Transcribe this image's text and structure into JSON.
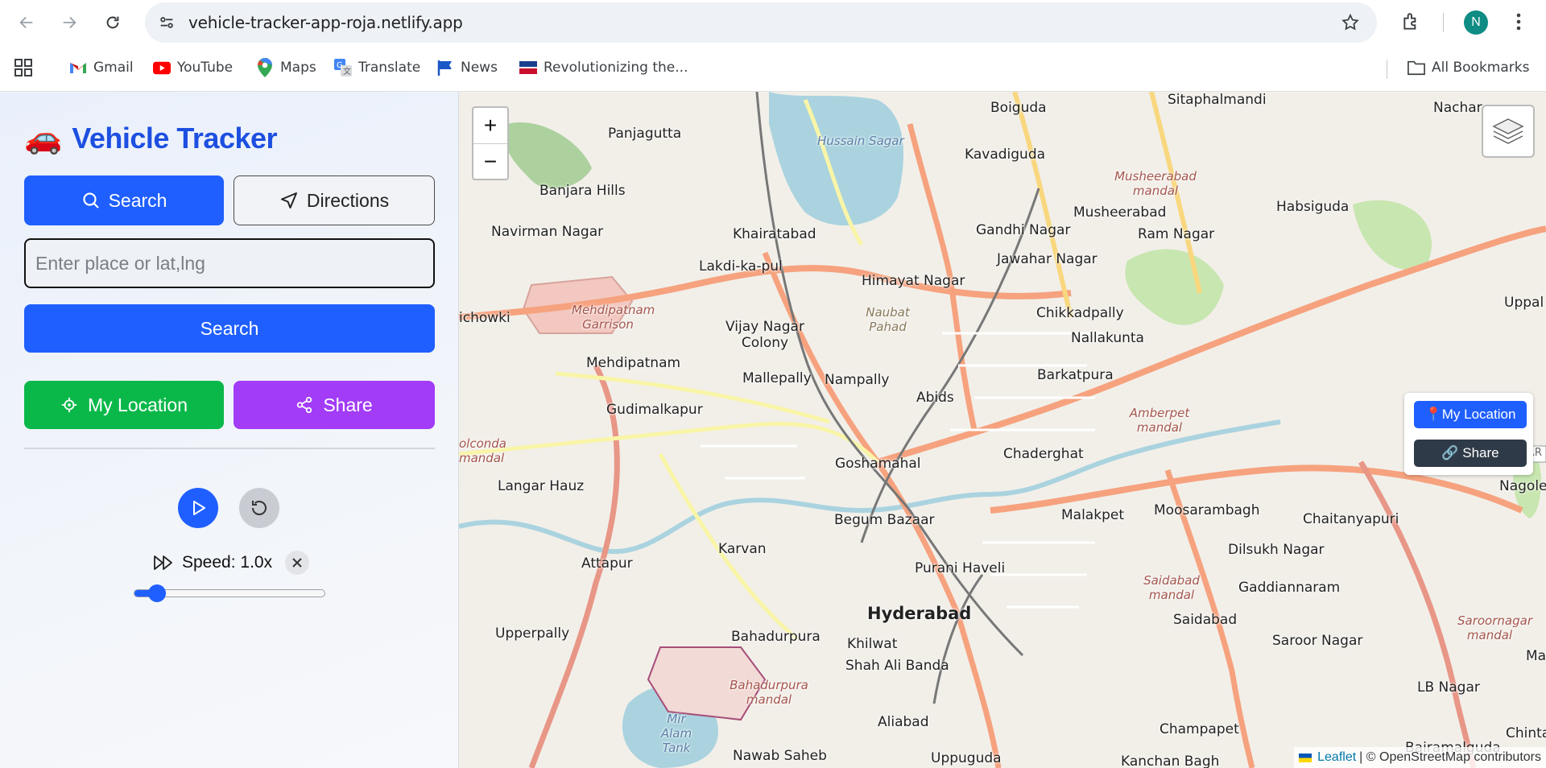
{
  "browser": {
    "url": "vehicle-tracker-app-roja.netlify.app",
    "profile_initial": "N",
    "bookmarks": [
      {
        "label": "Gmail",
        "icon": "gmail-icon"
      },
      {
        "label": "YouTube",
        "icon": "youtube-icon"
      },
      {
        "label": "Maps",
        "icon": "maps-icon"
      },
      {
        "label": "Translate",
        "icon": "translate-icon"
      },
      {
        "label": "News",
        "icon": "news-icon"
      },
      {
        "label": "Revolutionizing the...",
        "icon": "site-icon"
      }
    ],
    "all_bookmarks": "All Bookmarks"
  },
  "app": {
    "emoji": "🚗",
    "title": "Vehicle Tracker",
    "tabs": {
      "search": "Search",
      "directions": "Directions"
    },
    "place_placeholder": "Enter place or lat,lng",
    "place_value": "",
    "search_button": "Search",
    "my_location": "My Location",
    "share": "Share",
    "speed_label": "Speed: 1.0x",
    "speed_fraction": 0.12,
    "colors": {
      "primary": "#1f5fff",
      "location": "#0ab84a",
      "share": "#a23cf7"
    }
  },
  "map": {
    "zoom_in": "+",
    "zoom_out": "−",
    "panel": {
      "my_location": "📍My Location",
      "share": "🔗 Share"
    },
    "attribution": {
      "leaflet": "Leaflet",
      "rest": "| © OpenStreetMap contributors"
    },
    "labels": {
      "sitaphalmandi": "Sitaphalmandi",
      "nachar": "Nachar",
      "boiguda": "Boiguda",
      "panjagutta": "Panjagutta",
      "hussain_sagar": "Hussain Sagar",
      "kavadiguda": "Kavadiguda",
      "musheerabad_mandal": "Musheerabad mandal",
      "habsiguda": "Habsiguda",
      "banjara_hills": "Banjara Hills",
      "musheerabad": "Musheerabad",
      "navirman_nagar": "Navirman Nagar",
      "khairatabad": "Khairatabad",
      "gandhi_nagar": "Gandhi Nagar",
      "ram_nagar": "Ram Nagar",
      "jawahar_nagar": "Jawahar Nagar",
      "lakdi_ka_pul": "Lakdi-ka-pul",
      "himayat_nagar": "Himayat Nagar",
      "uppal": "Uppal",
      "mehdipatnam_garrison": "Mehdipatnam Garrison",
      "chikkadpally": "Chikkadpally",
      "ichowki": "ichowki",
      "vijay_nagar_colony": "Vijay Nagar Colony",
      "naubat_pahad": "Naubat Pahad",
      "nallakunta": "Nallakunta",
      "mehdipatnam": "Mehdipatnam",
      "mallepally": "Mallepally",
      "nampally": "Nampally",
      "barkatpura": "Barkatpura",
      "abids": "Abids",
      "gudimalkapur": "Gudimalkapur",
      "amberpet_mandal": "Amberpet mandal",
      "golconda_mandal": "olconda mandal",
      "chaderghat": "Chaderghat",
      "goshamahal": "Goshamahal",
      "langar_hauz": "Langar Hauz",
      "nagole": "Nagole",
      "malakpet": "Malakpet",
      "moosarambagh": "Moosarambagh",
      "chaitanyapuri": "Chaitanyapuri",
      "begum_bazaar": "Begum Bazaar",
      "karvan": "Karvan",
      "dilsukh_nagar": "Dilsukh Nagar",
      "attapur": "Attapur",
      "purani_haveli": "Purani Haveli",
      "saidabad_mandal": "Saidabad mandal",
      "gaddiannaram": "Gaddiannaram",
      "hyderabad": "Hyderabad",
      "saidabad": "Saidabad",
      "upperpally": "Upperpally",
      "saroornagar_mandal": "Saroornagar mandal",
      "bahadurpura": "Bahadurpura",
      "khilwat": "Khilwat",
      "saroor_nagar": "Saroor Nagar",
      "mans": "Mans",
      "shah_ali_banda": "Shah Ali Banda",
      "bahadurpura_mandal": "Bahadurpura mandal",
      "lb_nagar": "LB Nagar",
      "mir_alam_tank": "Mir Alam Tank",
      "aliabad": "Aliabad",
      "champapet": "Champapet",
      "chinta": "Chinta",
      "nawab_saheb": "Nawab Saheb",
      "uppuguda": "Uppuguda",
      "kanchan_bagh": "Kanchan Bagh",
      "bairamalguda": "Bairamalguda",
      "irr": "IRR"
    }
  }
}
